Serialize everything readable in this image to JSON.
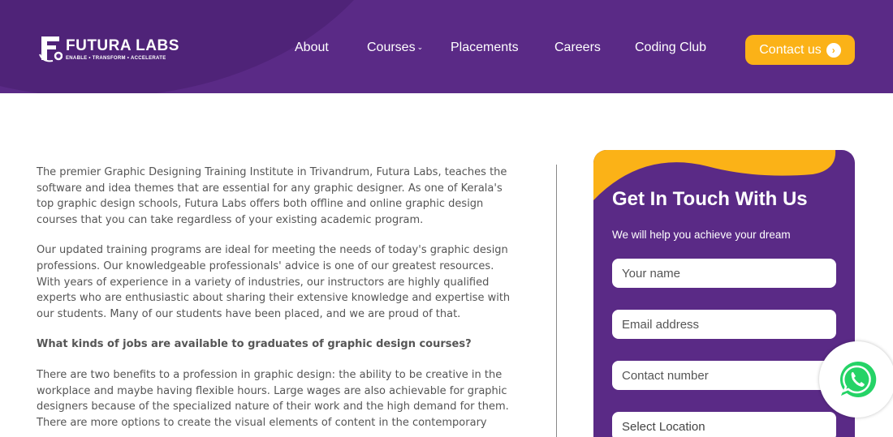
{
  "header": {
    "logo": {
      "name": "FUTURA LABS",
      "tagline": "ENABLE • TRANSFORM • ACCELERATE"
    },
    "nav": [
      {
        "label": "About",
        "has_dropdown": false
      },
      {
        "label": "Courses",
        "has_dropdown": true
      },
      {
        "label": "Placements",
        "has_dropdown": false
      },
      {
        "label": "Careers",
        "has_dropdown": false
      },
      {
        "label": "Coding Club",
        "has_dropdown": false
      }
    ],
    "cta": {
      "label": "Contact us",
      "icon": "chevron-right-circle-icon"
    }
  },
  "article": {
    "paragraphs": [
      "The premier Graphic Designing Training Institute in Trivandrum, Futura Labs, teaches the software and idea themes that are essential for any graphic designer. As one of Kerala's top graphic design schools, Futura Labs offers both offline and online graphic design courses that you can take regardless of your existing academic program.",
      "Our updated training programs are ideal for meeting the needs of today's graphic design professions. Our knowledgeable professionals' advice is one of our greatest resources. With years of experience in a variety of industries, our instructors are highly qualified experts who are enthusiastic about sharing their extensive knowledge and expertise with our students. Many of our students have been placed, and we are proud of that."
    ],
    "question": "What kinds of jobs are available to graduates of graphic design courses?",
    "answer": "There are two benefits to a profession in graphic design: the ability to be creative in the workplace and maybe having flexible hours. Large wages are also achievable for graphic designers because of the specialized nature of their work and the high demand for them. There are more options to create the visual elements of content in the contemporary"
  },
  "form": {
    "title": "Get In Touch With Us",
    "subtitle": "We will help you achieve your dream",
    "fields": {
      "name_placeholder": "Your name",
      "email_placeholder": "Email address",
      "phone_placeholder": "Contact number",
      "location_value": "Select Location"
    }
  },
  "floating": {
    "whatsapp_icon": "whatsapp-icon"
  },
  "colors": {
    "brand_purple": "#5a2a86",
    "accent_orange": "#fbb217",
    "whatsapp_green": "#25d366"
  }
}
